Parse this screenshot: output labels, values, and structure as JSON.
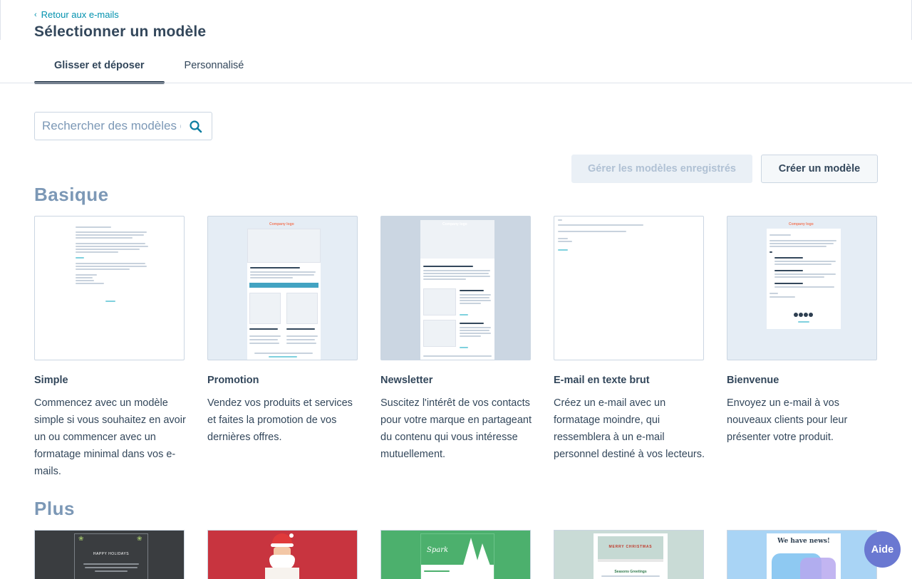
{
  "header": {
    "back_link": "Retour aux e-mails",
    "title": "Sélectionner un modèle"
  },
  "tabs": [
    {
      "label": "Glisser et déposer",
      "active": true
    },
    {
      "label": "Personnalisé",
      "active": false
    }
  ],
  "search": {
    "placeholder": "Rechercher des modèles d",
    "value": ""
  },
  "actions": {
    "manage_label": "Gérer les modèles enregistrés",
    "create_label": "Créer un modèle"
  },
  "sections": {
    "basic_title": "Basique",
    "more_title": "Plus"
  },
  "templates": [
    {
      "name": "Simple",
      "description": "Commencez avec un modèle simple si vous souhaitez en avoir un ou commencer avec un formatage minimal dans vos e-mails."
    },
    {
      "name": "Promotion",
      "description": "Vendez vos produits et services et faites la promotion de vos dernières offres."
    },
    {
      "name": "Newsletter",
      "description": "Suscitez l'intérêt de vos contacts pour votre marque en partageant du contenu qui vous intéresse mutuellement."
    },
    {
      "name": "E-mail en texte brut",
      "description": "Créez un e-mail avec un formatage moindre, qui ressemblera à un e-mail personnel destiné à vos lecteurs."
    },
    {
      "name": "Bienvenue",
      "description": "Envoyez un e-mail à vos nouveaux clients pour leur présenter votre produit."
    }
  ],
  "previews": {
    "company_logo": "Company logo",
    "holidays": "HAPPY HOLIDAYS",
    "spark": "Spark",
    "merry_christmas": "MERRY CHRISTMAS",
    "seasons_greetings": "Seasons Greetings",
    "news": "We have news!"
  },
  "help": {
    "label": "Aide"
  },
  "colors": {
    "accent": "#0091ae",
    "text": "#33475b",
    "section": "#7c98b6",
    "help": "#6a78d1"
  }
}
